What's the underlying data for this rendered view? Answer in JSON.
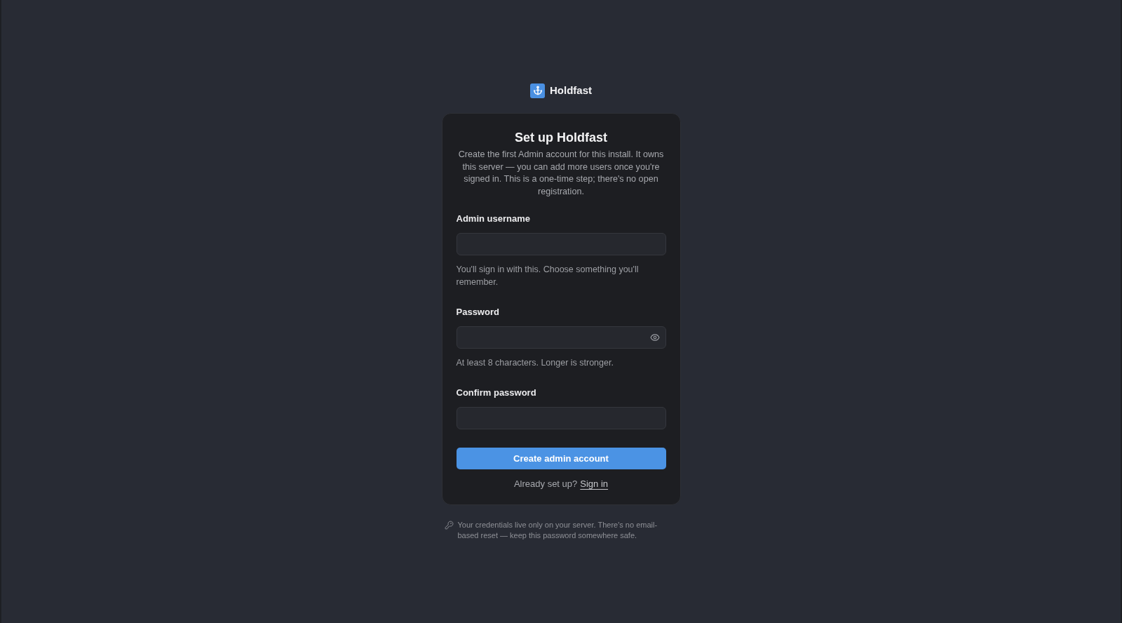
{
  "brand": {
    "name": "Holdfast"
  },
  "card": {
    "title": "Set up Holdfast",
    "description": "Create the first Admin account for this install. It owns this server — you can add more users once you're signed in. This is a one-time step; there's no open registration.",
    "fields": [
      {
        "label": "Admin username",
        "reveal_toggle": false,
        "help": "You'll sign in with this. Choose something you'll remember."
      },
      {
        "label": "Password",
        "reveal_toggle": true,
        "help": "At least 8 characters. Longer is stronger."
      },
      {
        "label": "Confirm password",
        "reveal_toggle": false
      }
    ],
    "submit_button": "Create admin account",
    "signin_prompt": {
      "text": "Already set up?",
      "link": "Sign in"
    }
  },
  "footer_note": "Your credentials live only on your server. There's no email-based reset — keep this password somewhere safe."
}
